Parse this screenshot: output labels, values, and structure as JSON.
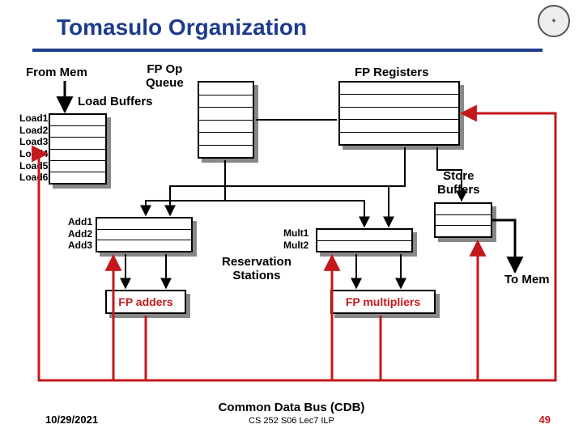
{
  "title": "Tomasulo Organization",
  "labels": {
    "from_mem": "From Mem",
    "fp_op_queue": "FP Op\nQueue",
    "load_buffers": "Load Buffers",
    "fp_registers": "FP Registers",
    "store_buffers": "Store\nBuffers",
    "reservation_stations": "Reservation\nStations",
    "to_mem": "To Mem",
    "fp_adders": "FP adders",
    "fp_multipliers": "FP multipliers",
    "cdb": "Common Data Bus (CDB)"
  },
  "load_rows": [
    "Load1",
    "Load2",
    "Load3",
    "Load4",
    "Load5",
    "Load6"
  ],
  "add_rows": [
    "Add1",
    "Add2",
    "Add3"
  ],
  "mult_rows": [
    "Mult1",
    "Mult2"
  ],
  "fp_op_queue_rows": 6,
  "fp_reg_rows": 5,
  "store_rows": 3,
  "footer": {
    "date": "10/29/2021",
    "course": "CS 252 S06 Lec7 ILP",
    "page": "49"
  },
  "colors": {
    "blue": "#1e3c8c",
    "red": "#c4191c"
  }
}
